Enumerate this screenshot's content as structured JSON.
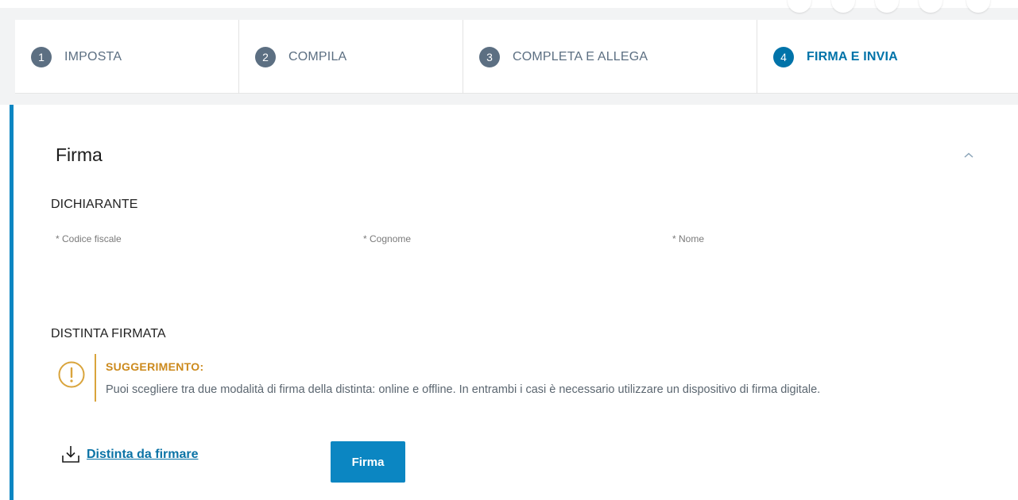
{
  "stepper": {
    "steps": [
      {
        "number": "1",
        "label": "IMPOSTA",
        "active": false
      },
      {
        "number": "2",
        "label": "COMPILA",
        "active": false
      },
      {
        "number": "3",
        "label": "COMPLETA E ALLEGA",
        "active": false
      },
      {
        "number": "4",
        "label": "FIRMA E INVIA",
        "active": true
      }
    ]
  },
  "section": {
    "title": "Firma",
    "chevron_icon": "chevron-up-icon"
  },
  "dichiarante": {
    "heading": "DICHIARANTE",
    "fields": [
      {
        "label": "* Codice fiscale",
        "value": ""
      },
      {
        "label": "* Cognome",
        "value": ""
      },
      {
        "label": "* Nome",
        "value": ""
      }
    ]
  },
  "distinta": {
    "heading": "DISTINTA FIRMATA",
    "callout": {
      "icon": "exclamation-circle-icon",
      "title": "SUGGERIMENTO:",
      "body": "Puoi scegliere tra due modalità di firma della distinta: online e offline. In entrambi i casi è necessario utilizzare un dispositivo di firma digitale."
    },
    "download_link": {
      "icon": "download-icon",
      "label": "Distinta da firmare"
    },
    "firma_button": "Firma"
  },
  "colors": {
    "primary": "#0b86c2",
    "link": "#0b73a6",
    "step_inactive": "#5c6f82",
    "warning": "#d9a43c",
    "warning_text": "#cc8a1d"
  }
}
